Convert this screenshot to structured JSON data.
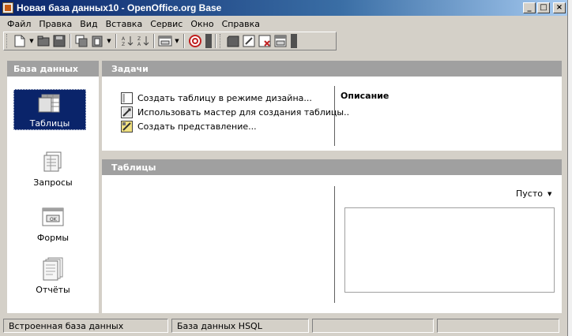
{
  "window": {
    "title": "Новая база данных10 - OpenOffice.org Base"
  },
  "menu": [
    "Файл",
    "Правка",
    "Вид",
    "Вставка",
    "Сервис",
    "Окно",
    "Справка"
  ],
  "sidebar": {
    "header": "База данных",
    "items": [
      {
        "label": "Таблицы",
        "icon": "tables-icon",
        "selected": true
      },
      {
        "label": "Запросы",
        "icon": "queries-icon"
      },
      {
        "label": "Формы",
        "icon": "forms-icon"
      },
      {
        "label": "Отчёты",
        "icon": "reports-icon"
      }
    ]
  },
  "tasks": {
    "header": "Задачи",
    "items": [
      {
        "label": "Создать таблицу в режиме дизайна...",
        "icon": "design-table-icon"
      },
      {
        "label": "Использовать мастер для создания таблицы..",
        "icon": "table-wizard-icon"
      },
      {
        "label": "Создать представление...",
        "icon": "create-view-icon"
      }
    ],
    "description_title": "Описание"
  },
  "tables": {
    "header": "Таблицы",
    "preview_select": "Пусто"
  },
  "statusbar": {
    "fields": [
      "Встроенная база данных",
      "База данных HSQL",
      "",
      ""
    ]
  },
  "colors": {
    "titlebar": "#0a246a",
    "selection": "#0a246a",
    "section_header": "#a0a0a0",
    "panel": "#ffffff",
    "chrome": "#d4d0c8"
  }
}
